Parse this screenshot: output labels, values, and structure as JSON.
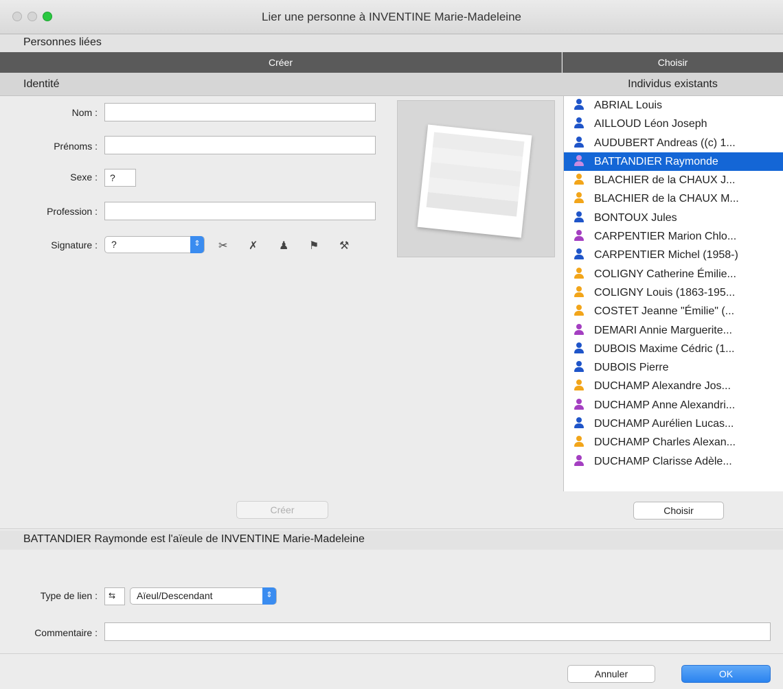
{
  "window": {
    "title": "Lier une personne à INVENTINE Marie-Madeleine"
  },
  "section_title": "Personnes liées",
  "creer_header": "Créer",
  "choisir_header": "Choisir",
  "identite_label": "Identité",
  "individus_label": "Individus existants",
  "form": {
    "nom_label": "Nom :",
    "nom_value": "",
    "prenoms_label": "Prénoms :",
    "prenoms_value": "",
    "sexe_label": "Sexe :",
    "sexe_value": "?",
    "profession_label": "Profession :",
    "profession_value": "",
    "signature_label": "Signature :",
    "signature_value": "?"
  },
  "people": [
    {
      "name": "ABRIAL Louis",
      "color": "blue"
    },
    {
      "name": "AILLOUD Léon Joseph",
      "color": "blue"
    },
    {
      "name": "AUDUBERT Andreas ((c) 1...",
      "color": "blue"
    },
    {
      "name": "BATTANDIER Raymonde",
      "color": "purple",
      "selected": true
    },
    {
      "name": "BLACHIER de la CHAUX J...",
      "color": "orange"
    },
    {
      "name": "BLACHIER de la CHAUX M...",
      "color": "orange"
    },
    {
      "name": "BONTOUX Jules",
      "color": "blue"
    },
    {
      "name": "CARPENTIER Marion Chlo...",
      "color": "purple"
    },
    {
      "name": "CARPENTIER Michel (1958-)",
      "color": "blue"
    },
    {
      "name": "COLIGNY Catherine Émilie...",
      "color": "orange"
    },
    {
      "name": "COLIGNY Louis (1863-195...",
      "color": "orange"
    },
    {
      "name": "COSTET Jeanne \"Émilie\" (...",
      "color": "orange"
    },
    {
      "name": "DEMARI Annie Marguerite...",
      "color": "purple"
    },
    {
      "name": "DUBOIS Maxime Cédric (1...",
      "color": "blue"
    },
    {
      "name": "DUBOIS Pierre",
      "color": "blue"
    },
    {
      "name": "DUCHAMP Alexandre Jos...",
      "color": "orange"
    },
    {
      "name": "DUCHAMP Anne Alexandri...",
      "color": "purple"
    },
    {
      "name": "DUCHAMP Aurélien Lucas...",
      "color": "blue"
    },
    {
      "name": "DUCHAMP Charles Alexan...",
      "color": "orange"
    },
    {
      "name": "DUCHAMP Clarisse Adèle...",
      "color": "purple"
    }
  ],
  "buttons": {
    "creer": "Créer",
    "choisir": "Choisir",
    "annuler": "Annuler",
    "ok": "OK"
  },
  "relation_summary": "BATTANDIER Raymonde est l'aïeule de INVENTINE Marie-Madeleine",
  "link": {
    "type_label": "Type de lien :",
    "type_value": "Aïeul/Descendant",
    "comment_label": "Commentaire :",
    "comment_value": ""
  },
  "colors": {
    "accent": "#1466d6",
    "blue": "#1f55c9",
    "purple": "#a43fc1",
    "orange": "#f2a51a",
    "dark_header": "#5a5a5a"
  }
}
